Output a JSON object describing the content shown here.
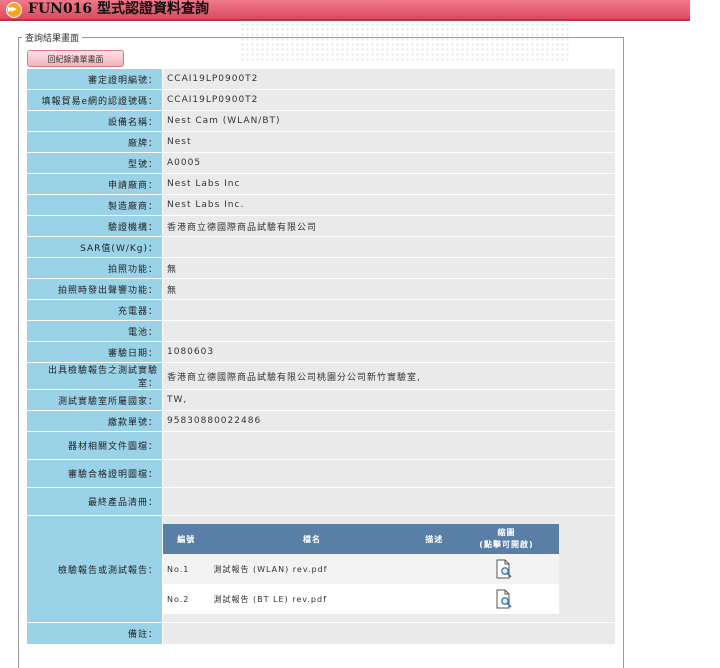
{
  "header": {
    "title": "FUN016 型式認證資料查詢"
  },
  "section": {
    "legend": "查詢結果畫面",
    "back_button": "回紀錄清單畫面"
  },
  "fields": [
    {
      "label": "審定證明編號：",
      "value": "CCAI19LP0900T2"
    },
    {
      "label": "填報貿易e網的認證號碼：",
      "value": "CCAI19LP0900T2"
    },
    {
      "label": "設備名稱：",
      "value": "Nest Cam (WLAN/BT)"
    },
    {
      "label": "廠牌：",
      "value": "Nest"
    },
    {
      "label": "型號：",
      "value": "A0005"
    },
    {
      "label": "申請廠商：",
      "value": "Nest Labs Inc"
    },
    {
      "label": "製造廠商：",
      "value": "Nest Labs Inc."
    },
    {
      "label": "驗證機構：",
      "value": "香港商立德國際商品試驗有限公司"
    },
    {
      "label": "SAR值(W/Kg)：",
      "value": ""
    },
    {
      "label": "拍照功能：",
      "value": "無"
    },
    {
      "label": "拍照時發出聲響功能：",
      "value": "無"
    },
    {
      "label": "充電器：",
      "value": ""
    },
    {
      "label": "電池：",
      "value": ""
    },
    {
      "label": "審驗日期：",
      "value": "1080603"
    },
    {
      "label": "出具檢驗報告之測試實驗室：",
      "value": "香港商立德國際商品試驗有限公司桃園分公司新竹實驗室,"
    },
    {
      "label": "測試實驗室所屬國家：",
      "value": "TW,"
    },
    {
      "label": "繳款單號：",
      "value": "95830880022486"
    },
    {
      "label": "器材相關文件圖檔：",
      "value": ""
    },
    {
      "label": "審驗合格證明圖檔：",
      "value": ""
    },
    {
      "label": "最終產品清冊：",
      "value": ""
    }
  ],
  "reports": {
    "label": "檢驗報告或測試報告：",
    "headers": {
      "number": "編號",
      "filename": "檔名",
      "description": "描述",
      "thumbnail_line1": "縮圖",
      "thumbnail_line2": "(點擊可開啟)"
    },
    "rows": [
      {
        "number": "No.1",
        "filename": "測試報告 (WLAN) rev.pdf",
        "description": ""
      },
      {
        "number": "No.2",
        "filename": "測試報告 (BT LE) rev.pdf",
        "description": ""
      }
    ]
  },
  "remarks": {
    "label": "備註：",
    "value": ""
  },
  "icons": {
    "title": "double-chevron-icon",
    "report": "pdf-magnifier-icon"
  }
}
